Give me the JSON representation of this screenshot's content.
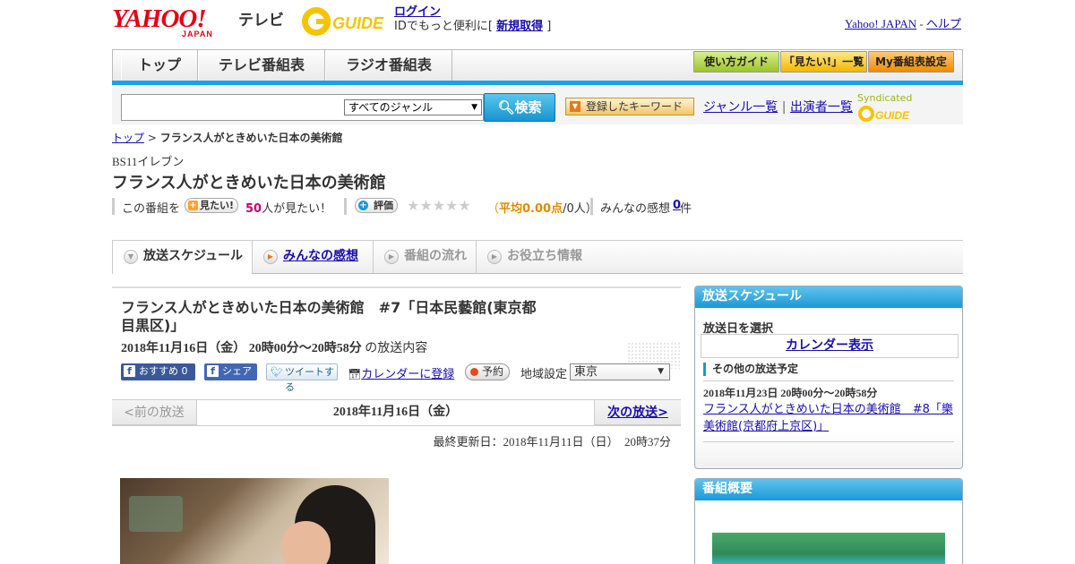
{
  "header": {
    "yahoo_logo": "YAHOO!",
    "yahoo_sub": "JAPAN",
    "tv_label": "テレビ",
    "gguide_logo": "GUIDE",
    "login_link": "ログイン",
    "login_text_pre": "IDでもっと便利に[",
    "signup_link": "新規取得",
    "login_text_post": "]",
    "yahoo_japan_link": "Yahoo! JAPAN",
    "dash": " - ",
    "help_link": "ヘルプ"
  },
  "gnav": {
    "tabs": [
      "トップ",
      "テレビ番組表",
      "ラジオ番組表"
    ],
    "utils": [
      "使い方ガイド",
      "「見たい!」一覧",
      "My番組表設定"
    ]
  },
  "search": {
    "genre_selected": "すべてのジャンル",
    "search_button": "検索",
    "keyword_button": "登録したキーワード",
    "genre_list_link": "ジャンル一覧",
    "divider": "|",
    "performer_list_link": "出演者一覧",
    "syndicated": "Syndicated"
  },
  "breadcrumb": {
    "top_link": "トップ",
    "separator": ">",
    "current": "フランス人がときめいた日本の美術館"
  },
  "program": {
    "channel": "BS11イレブン",
    "title": "フランス人がときめいた日本の美術館",
    "mitai_prefix": "この番組を",
    "mitai_button": "見たい!",
    "mitai_count": "50",
    "mitai_suffix": "人が見たい！",
    "rate_button": "評価",
    "stars": "★★★★★",
    "rating_pre": "（",
    "rating_avg": "平均0.00点",
    "rating_post": "/0人）",
    "impressions_label": "みんなの感想",
    "impressions_count": "0",
    "impressions_unit": "件"
  },
  "tabs": [
    {
      "label": "放送スケジュール",
      "active": true
    },
    {
      "label": "みんなの感想",
      "active": false
    },
    {
      "label": "番組の流れ",
      "active": false
    },
    {
      "label": "お役立ち情報",
      "active": false
    }
  ],
  "episode": {
    "title": "フランス人がときめいた日本の美術館　#7「日本民藝館(東京都目黒区)」",
    "datetime": "2018年11月16日（金）  20時00分～20時58分",
    "datetime_suffix": "の放送内容",
    "fb_recommend": "おすすめ 0",
    "fb_share": "シェア",
    "tweet": "ツイートする",
    "calendar_register": "カレンダーに登録",
    "reserve": "予約",
    "region_label": "地域設定",
    "region_selected": "東京"
  },
  "pager": {
    "prev": "<前の放送",
    "current": "2018年11月16日（金）",
    "next": "次の放送>"
  },
  "updated": "最終更新日：2018年11月11日（日）　20時37分",
  "sidebar": {
    "schedule_head": "放送スケジュール",
    "select_date": "放送日を選択",
    "calendar_link": "カレンダー表示",
    "other_head": "その他の放送予定",
    "other_date": "2018年11月23日  20時00分～20時58分",
    "other_link": "フランス人がときめいた日本の美術館　#8「樂美術館(京都府上京区)」",
    "summary_head": "番組概要"
  },
  "colors": {
    "brand_red": "#e60012",
    "accent_blue": "#1a99d4",
    "link": "#1a0dab",
    "highlight_pink": "#c8006e",
    "rating_orange": "#e08a00"
  }
}
